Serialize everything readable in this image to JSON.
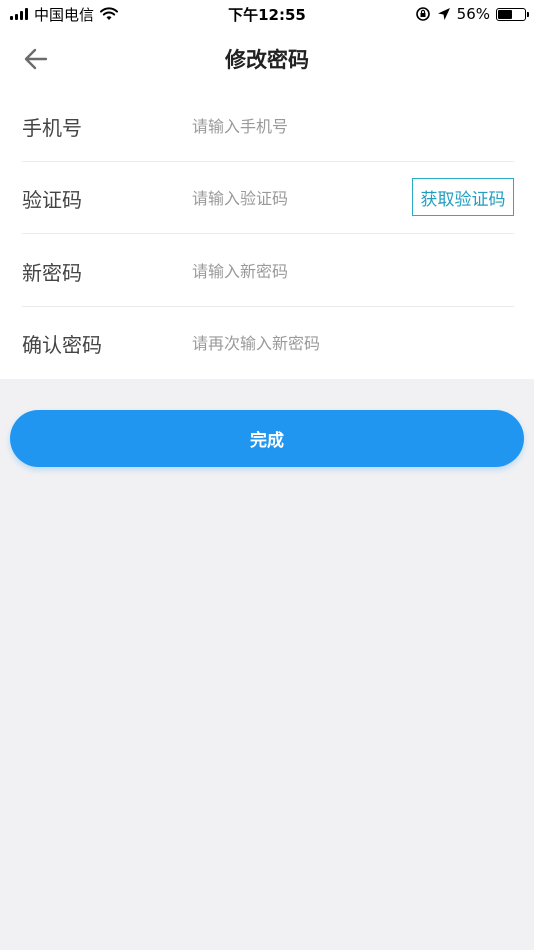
{
  "status_bar": {
    "carrier": "中国电信",
    "time": "下午12:55",
    "battery_percent": "56%",
    "battery_level": 0.56
  },
  "header": {
    "title": "修改密码",
    "back_icon": "arrow-left-icon"
  },
  "form": {
    "rows": [
      {
        "label": "手机号",
        "placeholder": "请输入手机号",
        "value": ""
      },
      {
        "label": "验证码",
        "placeholder": "请输入验证码",
        "value": ""
      },
      {
        "label": "新密码",
        "placeholder": "请输入新密码",
        "value": ""
      },
      {
        "label": "确认密码",
        "placeholder": "请再次输入新密码",
        "value": ""
      }
    ],
    "code_button_label": "获取验证码"
  },
  "submit": {
    "label": "完成"
  },
  "colors": {
    "primary": "#2196f1",
    "code_button": "#2bacc6",
    "background": "#f1f1f3"
  }
}
